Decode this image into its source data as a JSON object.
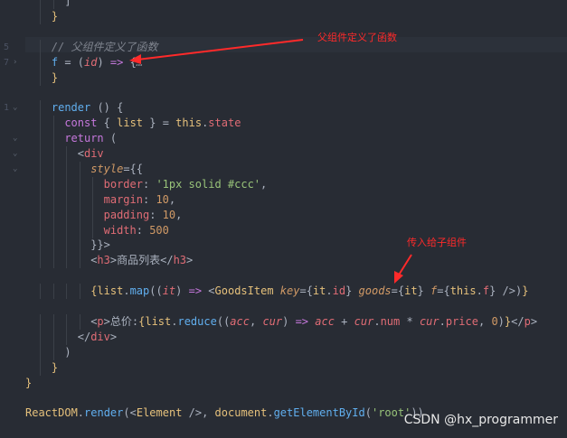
{
  "editor": {
    "lines": [
      {
        "n": "",
        "fold": "",
        "indent": 6,
        "segments": [
          {
            "t": "]",
            "c": "punc"
          }
        ]
      },
      {
        "n": "",
        "fold": "",
        "indent": 4,
        "segments": [
          {
            "t": "}",
            "c": "gold"
          }
        ]
      },
      {
        "n": "",
        "fold": "",
        "indent": 0,
        "segments": []
      },
      {
        "n": "5",
        "fold": "",
        "indent": 4,
        "segments": [
          {
            "t": "// 父组件定义了函数",
            "c": "cmt"
          }
        ]
      },
      {
        "n": "7",
        "fold": "›",
        "indent": 4,
        "segments": [
          {
            "t": "f",
            "c": "fn"
          },
          {
            "t": " = (",
            "c": "punc"
          },
          {
            "t": "id",
            "c": "param"
          },
          {
            "t": ") ",
            "c": "punc"
          },
          {
            "t": "=>",
            "c": "kw"
          },
          {
            "t": " {",
            "c": "punc"
          },
          {
            "t": "…",
            "c": "cmt"
          }
        ]
      },
      {
        "n": "",
        "fold": "",
        "indent": 4,
        "segments": [
          {
            "t": "}",
            "c": "gold"
          }
        ]
      },
      {
        "n": "",
        "fold": "",
        "indent": 0,
        "segments": []
      },
      {
        "n": "1",
        "fold": "⌄",
        "indent": 4,
        "segments": [
          {
            "t": "render",
            "c": "fn"
          },
          {
            "t": " () {",
            "c": "punc"
          }
        ]
      },
      {
        "n": "",
        "fold": "",
        "indent": 6,
        "segments": [
          {
            "t": "const",
            "c": "kw"
          },
          {
            "t": " { ",
            "c": "punc"
          },
          {
            "t": "list",
            "c": "gold"
          },
          {
            "t": " } = ",
            "c": "punc"
          },
          {
            "t": "this",
            "c": "gold"
          },
          {
            "t": ".",
            "c": "punc"
          },
          {
            "t": "state",
            "c": "prop"
          }
        ]
      },
      {
        "n": "",
        "fold": "⌄",
        "indent": 6,
        "segments": [
          {
            "t": "return",
            "c": "kw"
          },
          {
            "t": " (",
            "c": "punc"
          }
        ]
      },
      {
        "n": "",
        "fold": "⌄",
        "indent": 8,
        "segments": [
          {
            "t": "<",
            "c": "punc"
          },
          {
            "t": "div",
            "c": "tag"
          }
        ]
      },
      {
        "n": "",
        "fold": "⌄",
        "indent": 10,
        "segments": [
          {
            "t": "style",
            "c": "attr"
          },
          {
            "t": "={{",
            "c": "punc"
          }
        ]
      },
      {
        "n": "",
        "fold": "",
        "indent": 12,
        "segments": [
          {
            "t": "border",
            "c": "prop"
          },
          {
            "t": ": ",
            "c": "punc"
          },
          {
            "t": "'1px solid #ccc'",
            "c": "str"
          },
          {
            "t": ",",
            "c": "punc"
          }
        ]
      },
      {
        "n": "",
        "fold": "",
        "indent": 12,
        "segments": [
          {
            "t": "margin",
            "c": "prop"
          },
          {
            "t": ": ",
            "c": "punc"
          },
          {
            "t": "10",
            "c": "num"
          },
          {
            "t": ",",
            "c": "punc"
          }
        ]
      },
      {
        "n": "",
        "fold": "",
        "indent": 12,
        "segments": [
          {
            "t": "padding",
            "c": "prop"
          },
          {
            "t": ": ",
            "c": "punc"
          },
          {
            "t": "10",
            "c": "num"
          },
          {
            "t": ",",
            "c": "punc"
          }
        ]
      },
      {
        "n": "",
        "fold": "",
        "indent": 12,
        "segments": [
          {
            "t": "width",
            "c": "prop"
          },
          {
            "t": ": ",
            "c": "punc"
          },
          {
            "t": "500",
            "c": "num"
          }
        ]
      },
      {
        "n": "",
        "fold": "",
        "indent": 10,
        "segments": [
          {
            "t": "}}>",
            "c": "punc"
          }
        ]
      },
      {
        "n": "",
        "fold": "",
        "indent": 10,
        "segments": [
          {
            "t": "<",
            "c": "punc"
          },
          {
            "t": "h3",
            "c": "tag"
          },
          {
            "t": ">商品列表</",
            "c": "punc"
          },
          {
            "t": "h3",
            "c": "tag"
          },
          {
            "t": ">",
            "c": "punc"
          }
        ]
      },
      {
        "n": "",
        "fold": "",
        "indent": 0,
        "segments": []
      },
      {
        "n": "",
        "fold": "",
        "indent": 10,
        "segments": [
          {
            "t": "{",
            "c": "gold"
          },
          {
            "t": "list",
            "c": "gold"
          },
          {
            "t": ".",
            "c": "punc"
          },
          {
            "t": "map",
            "c": "fn"
          },
          {
            "t": "((",
            "c": "punc"
          },
          {
            "t": "it",
            "c": "param"
          },
          {
            "t": ") ",
            "c": "punc"
          },
          {
            "t": "=>",
            "c": "kw"
          },
          {
            "t": " <",
            "c": "punc"
          },
          {
            "t": "GoodsItem",
            "c": "gold"
          },
          {
            "t": " ",
            "c": "punc"
          },
          {
            "t": "key",
            "c": "attr"
          },
          {
            "t": "={",
            "c": "punc"
          },
          {
            "t": "it",
            "c": "gold"
          },
          {
            "t": ".",
            "c": "punc"
          },
          {
            "t": "id",
            "c": "prop"
          },
          {
            "t": "} ",
            "c": "punc"
          },
          {
            "t": "goods",
            "c": "attr"
          },
          {
            "t": "={",
            "c": "punc"
          },
          {
            "t": "it",
            "c": "gold"
          },
          {
            "t": "} ",
            "c": "punc"
          },
          {
            "t": "f",
            "c": "attr"
          },
          {
            "t": "={",
            "c": "punc"
          },
          {
            "t": "this",
            "c": "gold"
          },
          {
            "t": ".",
            "c": "punc"
          },
          {
            "t": "f",
            "c": "prop"
          },
          {
            "t": "} />)",
            "c": "punc"
          },
          {
            "t": "}",
            "c": "gold"
          }
        ]
      },
      {
        "n": "",
        "fold": "",
        "indent": 0,
        "segments": []
      },
      {
        "n": "",
        "fold": "",
        "indent": 10,
        "segments": [
          {
            "t": "<",
            "c": "punc"
          },
          {
            "t": "p",
            "c": "tag"
          },
          {
            "t": ">总价:",
            "c": "punc"
          },
          {
            "t": "{",
            "c": "gold"
          },
          {
            "t": "list",
            "c": "gold"
          },
          {
            "t": ".",
            "c": "punc"
          },
          {
            "t": "reduce",
            "c": "fn"
          },
          {
            "t": "((",
            "c": "punc"
          },
          {
            "t": "acc",
            "c": "param"
          },
          {
            "t": ", ",
            "c": "punc"
          },
          {
            "t": "cur",
            "c": "param"
          },
          {
            "t": ") ",
            "c": "punc"
          },
          {
            "t": "=>",
            "c": "kw"
          },
          {
            "t": " ",
            "c": "punc"
          },
          {
            "t": "acc",
            "c": "param"
          },
          {
            "t": " + ",
            "c": "punc"
          },
          {
            "t": "cur",
            "c": "param"
          },
          {
            "t": ".",
            "c": "punc"
          },
          {
            "t": "num",
            "c": "prop"
          },
          {
            "t": " * ",
            "c": "punc"
          },
          {
            "t": "cur",
            "c": "param"
          },
          {
            "t": ".",
            "c": "punc"
          },
          {
            "t": "price",
            "c": "prop"
          },
          {
            "t": ", ",
            "c": "punc"
          },
          {
            "t": "0",
            "c": "num"
          },
          {
            "t": ")",
            "c": "punc"
          },
          {
            "t": "}",
            "c": "gold"
          },
          {
            "t": "</",
            "c": "punc"
          },
          {
            "t": "p",
            "c": "tag"
          },
          {
            "t": ">",
            "c": "punc"
          }
        ]
      },
      {
        "n": "",
        "fold": "",
        "indent": 8,
        "segments": [
          {
            "t": "</",
            "c": "punc"
          },
          {
            "t": "div",
            "c": "tag"
          },
          {
            "t": ">",
            "c": "punc"
          }
        ]
      },
      {
        "n": "",
        "fold": "",
        "indent": 6,
        "segments": [
          {
            "t": ")",
            "c": "punc"
          }
        ]
      },
      {
        "n": "",
        "fold": "",
        "indent": 4,
        "segments": [
          {
            "t": "}",
            "c": "gold"
          }
        ]
      },
      {
        "n": "",
        "fold": "",
        "indent": 0,
        "segments": [
          {
            "t": "}",
            "c": "gold"
          }
        ]
      },
      {
        "n": "",
        "fold": "",
        "indent": 0,
        "segments": []
      },
      {
        "n": "",
        "fold": "",
        "indent": 0,
        "segments": [
          {
            "t": "ReactDOM",
            "c": "gold"
          },
          {
            "t": ".",
            "c": "punc"
          },
          {
            "t": "render",
            "c": "fn"
          },
          {
            "t": "(<",
            "c": "punc"
          },
          {
            "t": "Element",
            "c": "gold"
          },
          {
            "t": " />, ",
            "c": "punc"
          },
          {
            "t": "document",
            "c": "gold"
          },
          {
            "t": ".",
            "c": "punc"
          },
          {
            "t": "getElementById",
            "c": "fn"
          },
          {
            "t": "(",
            "c": "punc"
          },
          {
            "t": "'root'",
            "c": "str"
          },
          {
            "t": "))",
            "c": "punc"
          }
        ]
      }
    ]
  },
  "annotations": {
    "parent_defines_function": "父组件定义了函数",
    "pass_to_child": "传入给子组件",
    "color": "#ff2a2a"
  },
  "watermark": "CSDN @hx_programmer"
}
